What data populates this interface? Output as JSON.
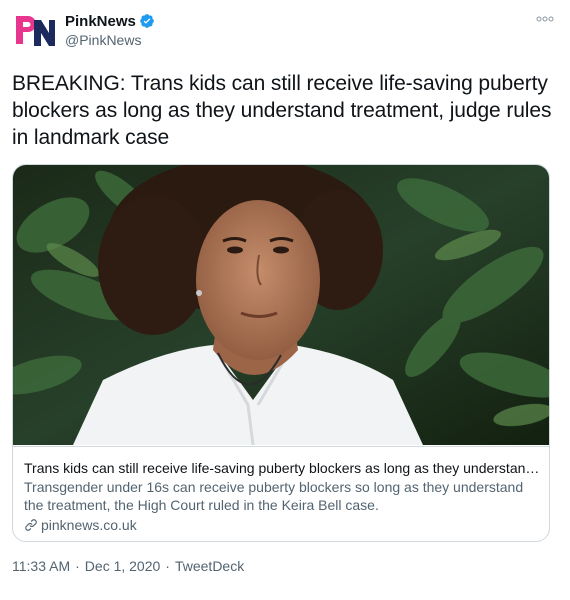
{
  "account": {
    "display_name": "PinkNews",
    "handle": "@PinkNews",
    "logo_letters": "PN",
    "verified": true
  },
  "tweet": {
    "text": "BREAKING: Trans kids can still receive life-saving puberty blockers as long as they understand treatment, judge rules in landmark case"
  },
  "card": {
    "title": "Trans kids can still receive life-saving puberty blockers as long as they understands treatment...",
    "description": "Transgender under 16s can receive puberty blockers so long as they understand the treatment, the High Court ruled in the Keira Bell case.",
    "domain": "pinknews.co.uk",
    "link_icon": "link-icon",
    "image_subject": "Young person with curly hair in white shirt, foliage background"
  },
  "meta": {
    "time": "11:33 AM",
    "date": "Dec 1, 2020",
    "source": "TweetDeck",
    "separator": "·"
  },
  "colors": {
    "logo_pink": "#e8368f",
    "logo_blue": "#1d2a5e",
    "verified_blue": "#1d9bf0",
    "text_secondary": "#536471",
    "border": "#cfd9de"
  },
  "icons": [
    "more-icon",
    "verified-icon",
    "link-icon"
  ]
}
